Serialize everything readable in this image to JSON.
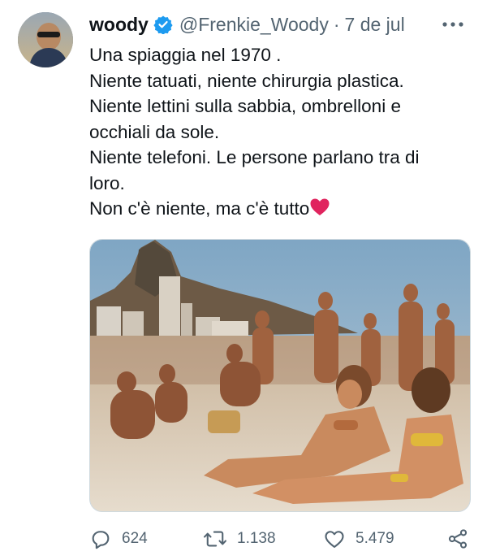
{
  "tweet": {
    "author_name": "woody",
    "handle": "@Frenkie_Woody",
    "separator": "·",
    "date": "7 de jul",
    "lines": [
      "Una spiaggia nel 1970 .",
      "Niente tatuati, niente chirurgia plastica.",
      "Niente lettini sulla sabbia, ombrelloni e",
      "occhiali da sole.",
      "Niente telefoni. Le persone parlano tra di",
      "loro.",
      "Non c'è niente, ma c'è tutto"
    ]
  },
  "actions": {
    "replies": "624",
    "retweets": "1.138",
    "likes": "5.479"
  },
  "colors": {
    "verified": "#1d9bf0",
    "heart": "#e0245e",
    "muted": "#536471"
  },
  "icons": [
    "verified-badge-icon",
    "more-icon",
    "reply-icon",
    "retweet-icon",
    "like-icon",
    "share-icon"
  ]
}
